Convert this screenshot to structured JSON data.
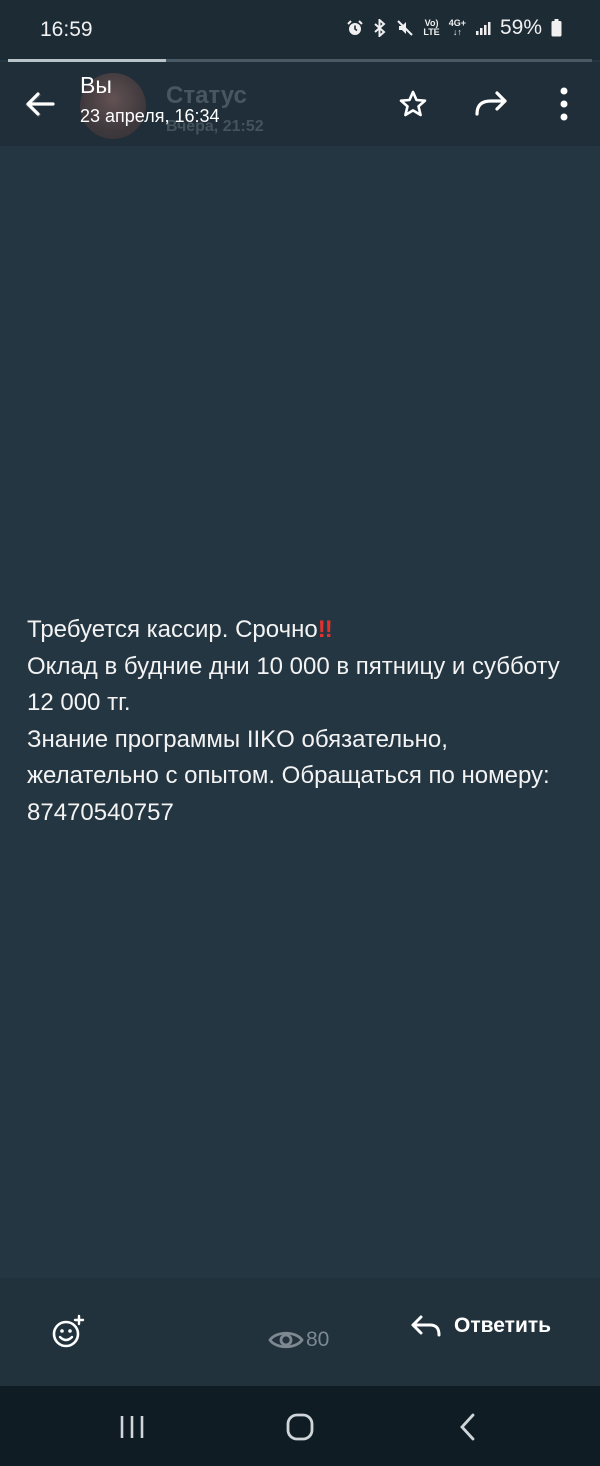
{
  "status_bar": {
    "time": "16:59",
    "volte_label_top": "Vo)",
    "volte_label_bottom": "LTE",
    "network_label": "4G+",
    "battery_percent": "59%",
    "icons": [
      "alarm-icon",
      "bluetooth-icon",
      "mute-icon",
      "volte-icon",
      "network-4g-icon",
      "signal-icon",
      "battery-icon"
    ]
  },
  "progress": {
    "fraction": 0.27
  },
  "header": {
    "title": "Вы",
    "subtitle": "23 апреля, 16:34",
    "ghost_title": "Статус",
    "ghost_subtitle": "Вчера, 21:52"
  },
  "message": {
    "line1": "Требуется кассир. Срочно",
    "line1_emoji": "!!",
    "line2": "Оклад в будние дни 10 000 в пятницу и субботу 12 000 тг.",
    "line3": "Знание программы  IIKO  обязательно, желательно с опытом. Обращаться по номеру: 87470540757"
  },
  "footer": {
    "views_count": "80",
    "reply_label": "Ответить"
  },
  "colors": {
    "background": "#243642",
    "header": "#1f2e38",
    "accent_red": "#e0312f",
    "muted": "#7d8890"
  }
}
